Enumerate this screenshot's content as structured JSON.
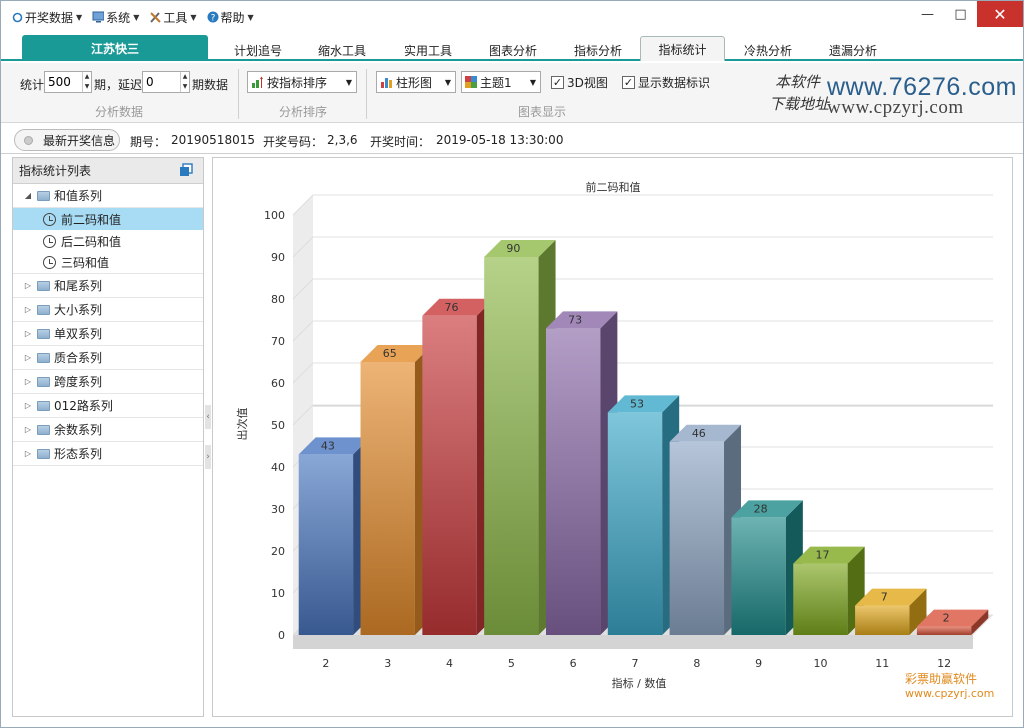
{
  "menu": [
    {
      "label": "开奖数据",
      "icon": "ring-icon"
    },
    {
      "label": "系统",
      "icon": "monitor-icon"
    },
    {
      "label": "工具",
      "icon": "tools-icon"
    },
    {
      "label": "帮助",
      "icon": "help-icon"
    }
  ],
  "window": {
    "minimize": "—",
    "maximize": "□",
    "close": "✕"
  },
  "tabs": {
    "main": "江苏快三",
    "items": [
      "计划追号",
      "缩水工具",
      "实用工具",
      "图表分析",
      "指标分析",
      "指标统计",
      "冷热分析",
      "遗漏分析"
    ],
    "active": "指标统计"
  },
  "ribbon": {
    "stat_label": "统计",
    "stat_value": "500",
    "period_label": "期，延迟",
    "delay_value": "0",
    "period_data_label": "期数据",
    "group1_caption": "分析数据",
    "sort_value": "按指标排序",
    "group2_caption": "分析排序",
    "chart_type_value": "柱形图",
    "theme_value": "主题1",
    "view3d_label": "3D视图",
    "view3d_checked": true,
    "show_labels_label": "显示数据标识",
    "show_labels_checked": true,
    "group3_caption": "图表显示"
  },
  "logo": {
    "cn1": "本软件",
    "cn2": "下载地址",
    "url1": "www.76276.com",
    "url2": "www.cpzyrj.com"
  },
  "info": {
    "button": "最新开奖信息",
    "issue_label": "期号：",
    "issue_value": "20190518015",
    "numbers_label": "开奖号码：",
    "numbers_value": "2,3,6",
    "time_label": "开奖时间：",
    "time_value": "2019-05-18 13:30:00"
  },
  "tree": {
    "title": "指标统计列表",
    "groups": [
      {
        "label": "和值系列",
        "expanded": true,
        "children": [
          "前二码和值",
          "后二码和值",
          "三码和值"
        ],
        "selected": "前二码和值"
      },
      {
        "label": "和尾系列"
      },
      {
        "label": "大小系列"
      },
      {
        "label": "单双系列"
      },
      {
        "label": "质合系列"
      },
      {
        "label": "跨度系列"
      },
      {
        "label": "012路系列"
      },
      {
        "label": "余数系列"
      },
      {
        "label": "形态系列"
      }
    ]
  },
  "chart_data": {
    "type": "bar",
    "title": "前二码和值",
    "xlabel": "指标 / 数值",
    "ylabel": "出次值",
    "categories": [
      "2",
      "3",
      "4",
      "5",
      "6",
      "7",
      "8",
      "9",
      "10",
      "11",
      "12"
    ],
    "values": [
      43,
      65,
      76,
      90,
      73,
      53,
      46,
      28,
      17,
      7,
      2
    ],
    "ylim": [
      0,
      100
    ],
    "yticks": [
      0,
      10,
      20,
      30,
      40,
      50,
      60,
      70,
      80,
      90,
      100
    ],
    "grid": true,
    "view3d": true,
    "colors": [
      "#4a77c0",
      "#e48c2c",
      "#c8393b",
      "#8fba4a",
      "#8a6aa8",
      "#3aa8c8",
      "#8ea6c4",
      "#1f8a8a",
      "#7ea81e",
      "#e0a81c",
      "#d8543c"
    ]
  },
  "watermark": {
    "line1": "彩票助赢软件",
    "line2": "www.cpzyrj.com"
  }
}
